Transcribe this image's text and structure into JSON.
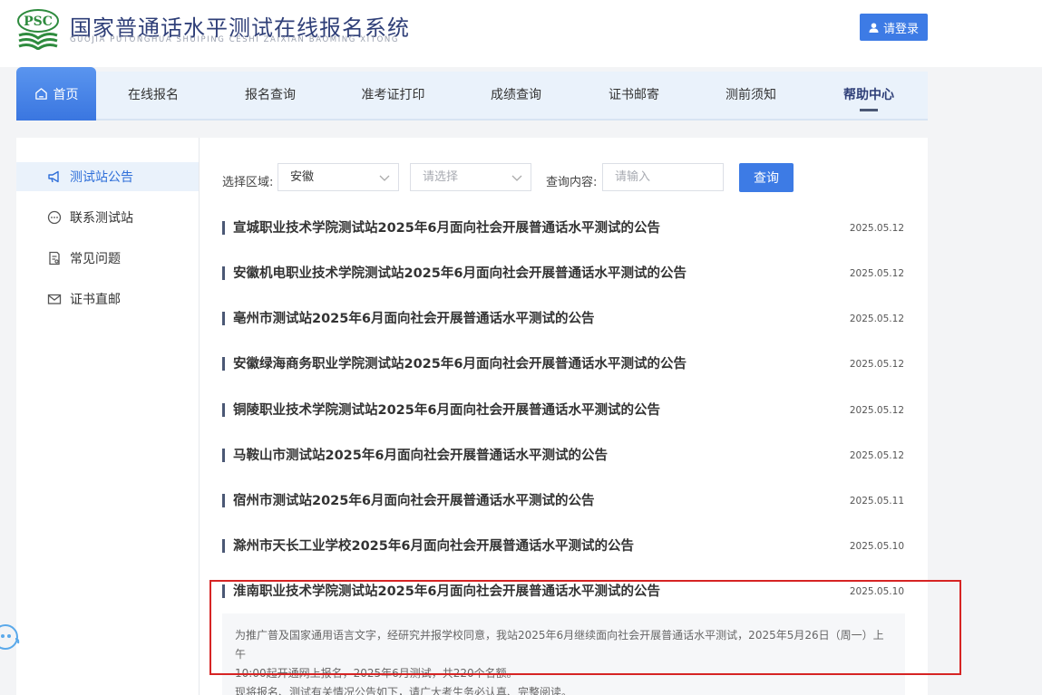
{
  "header": {
    "logo_text": "PSC",
    "site_title": "国家普通话水平测试在线报名系统",
    "site_subtitle": "GUOJIA PUTONGHUA SHUIPING CESHI ZAIXIAN BAOMING XITONG",
    "login_label": "请登录"
  },
  "nav": {
    "home": "首页",
    "items": [
      "在线报名",
      "报名查询",
      "准考证打印",
      "成绩查询",
      "证书邮寄",
      "测前须知",
      "帮助中心"
    ]
  },
  "sidebar": {
    "items": [
      "测试站公告",
      "联系测试站",
      "常见问题",
      "证书直邮"
    ]
  },
  "filters": {
    "region_label": "选择区域:",
    "region_value": "安徽",
    "sub_region_placeholder": "请选择",
    "query_label": "查询内容:",
    "query_placeholder": "请输入",
    "query_button": "查询"
  },
  "notices": [
    {
      "title": "宣城职业技术学院测试站2025年6月面向社会开展普通话水平测试的公告",
      "date": "2025.05.12"
    },
    {
      "title": "安徽机电职业技术学院测试站2025年6月面向社会开展普通话水平测试的公告",
      "date": "2025.05.12"
    },
    {
      "title": "亳州市测试站2025年6月面向社会开展普通话水平测试的公告",
      "date": "2025.05.12"
    },
    {
      "title": "安徽绿海商务职业学院测试站2025年6月面向社会开展普通话水平测试的公告",
      "date": "2025.05.12"
    },
    {
      "title": "铜陵职业技术学院测试站2025年6月面向社会开展普通话水平测试的公告",
      "date": "2025.05.12"
    },
    {
      "title": "马鞍山市测试站2025年6月面向社会开展普通话水平测试的公告",
      "date": "2025.05.12"
    },
    {
      "title": "宿州市测试站2025年6月面向社会开展普通话水平测试的公告",
      "date": "2025.05.11"
    },
    {
      "title": "滁州市天长工业学校2025年6月面向社会开展普通话水平测试的公告",
      "date": "2025.05.10"
    },
    {
      "title": "淮南职业技术学院测试站2025年6月面向社会开展普通话水平测试的公告",
      "date": "2025.05.10"
    }
  ],
  "expanded_notice": {
    "line1": "为推广普及国家通用语言文字，经研究并报学校同意，我站2025年6月继续面向社会开展普通话水平测试，2025年5月26日（周一）上午",
    "line2": "10:00起开通网上报名，2025年6月测试，共220个名额。",
    "line3": "现将报名、测试有关情况公告如下，请广大考生务必认真、完整阅读。"
  },
  "colors": {
    "primary": "#3d7be5",
    "nav_bg": "#eaf2fb",
    "highlight": "#d62424"
  }
}
